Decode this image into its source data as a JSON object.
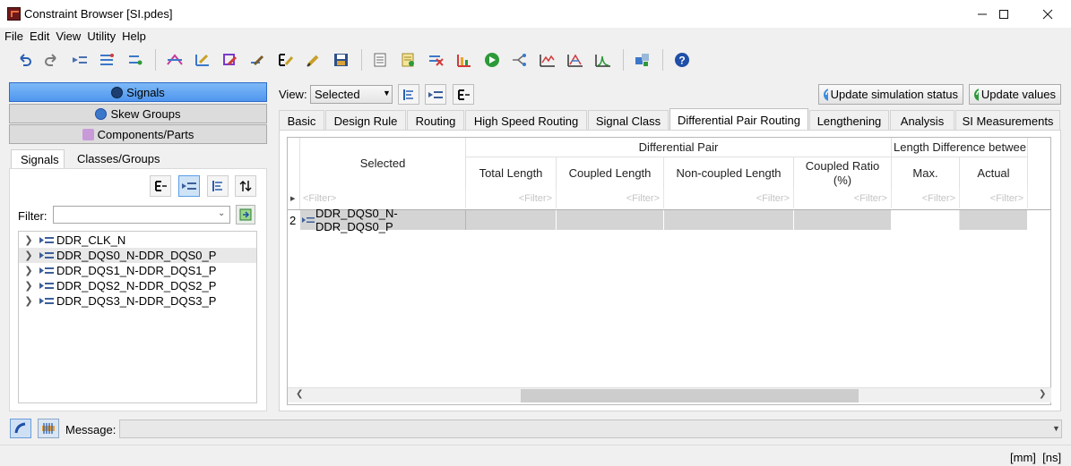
{
  "window": {
    "title": "Constraint Browser [SI.pdes]"
  },
  "menu": [
    "File",
    "Edit",
    "View",
    "Utility",
    "Help"
  ],
  "left": {
    "nav": [
      "Signals",
      "Skew Groups",
      "Components/Parts"
    ],
    "subtabs": [
      "Signals",
      "Classes/Groups"
    ],
    "filter_label": "Filter:",
    "filter_value": "",
    "tree": [
      "DDR_CLK_N",
      "DDR_DQS0_N-DDR_DQS0_P",
      "DDR_DQS1_N-DDR_DQS1_P",
      "DDR_DQS2_N-DDR_DQS2_P",
      "DDR_DQS3_N-DDR_DQS3_P"
    ],
    "selected_index": 1
  },
  "view": {
    "label": "View:",
    "selected": "Selected"
  },
  "actions": {
    "update_sim": "Update simulation status",
    "update_values": "Update values"
  },
  "tabs": [
    "Basic",
    "Design Rule",
    "Routing",
    "High Speed Routing",
    "Signal Class",
    "Differential Pair Routing",
    "Lengthening",
    "Analysis",
    "SI Measurements"
  ],
  "active_tab": 5,
  "grid": {
    "group_diff": "Differential Pair",
    "group_len": "Length Difference betwee...",
    "col_selected": "Selected",
    "col_total": "Total Length",
    "col_coupled": "Coupled Length",
    "col_noncoupled": "Non-coupled Length",
    "col_ratio": "Coupled Ratio\n(%)",
    "col_max": "Max.",
    "col_actual": "Actual",
    "filter_placeholder": "<Filter>",
    "row_number": "2",
    "row_name": "DDR_DQS0_N-DDR_DQS0_P"
  },
  "bottom": {
    "message_label": "Message:",
    "units": "[mm]  [ns]"
  },
  "icons": [
    "undo-icon",
    "redo-icon",
    "help-icon",
    "minimize-icon",
    "maximize-icon",
    "close-icon"
  ],
  "colors": {
    "accent": "#4f96ee",
    "grid_gray": "#d4d4d4"
  }
}
